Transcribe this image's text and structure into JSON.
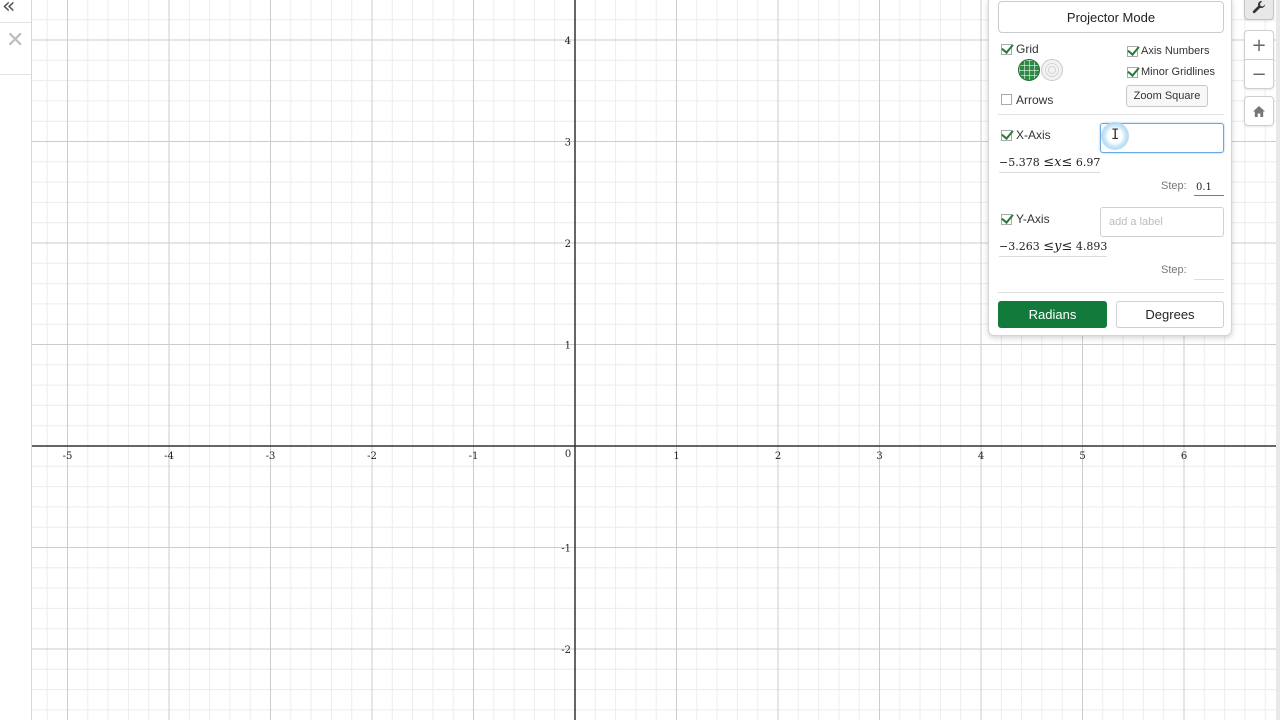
{
  "graph": {
    "x_ticks": [
      "-5",
      "-4",
      "-3",
      "-2",
      "-1",
      "0",
      "1",
      "2",
      "3",
      "4",
      "5",
      "6"
    ],
    "y_ticks": [
      "4",
      "3",
      "2",
      "1",
      "-1",
      "-2"
    ]
  },
  "settings": {
    "projector_mode": "Projector Mode",
    "grid_label": "Grid",
    "axis_numbers_label": "Axis Numbers",
    "minor_gridlines_label": "Minor Gridlines",
    "zoom_square_label": "Zoom Square",
    "arrows_label": "Arrows",
    "x_axis": {
      "label": "X-Axis",
      "input_value": "",
      "min": "−5.378",
      "max": "6.97",
      "var": "x",
      "step_label": "Step:",
      "step_value": "0.1"
    },
    "y_axis": {
      "label": "Y-Axis",
      "placeholder": "add a label",
      "min": "−3.263",
      "max": "4.893",
      "var": "y",
      "step_label": "Step:",
      "step_value": ""
    },
    "leq_symbol": "≤",
    "radians_label": "Radians",
    "degrees_label": "Degrees"
  },
  "side_buttons": {
    "zoom_in": "+",
    "zoom_out": "−"
  },
  "colors": {
    "accent": "#127a3a",
    "major_grid": "#cccccc",
    "minor_grid": "#ececec",
    "axis": "#333333"
  }
}
